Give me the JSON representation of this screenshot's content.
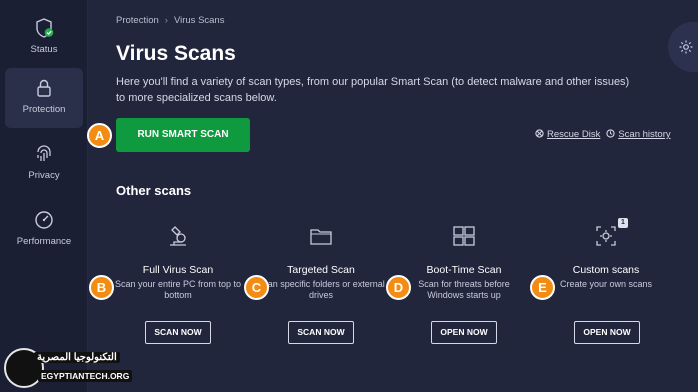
{
  "sidebar": {
    "items": [
      {
        "label": "Status",
        "icon": "shield-check-icon"
      },
      {
        "label": "Protection",
        "icon": "lock-icon"
      },
      {
        "label": "Privacy",
        "icon": "fingerprint-icon"
      },
      {
        "label": "Performance",
        "icon": "speedometer-icon"
      }
    ],
    "status_ok_color": "#22b14c"
  },
  "breadcrumb": {
    "parent": "Protection",
    "separator": "›",
    "current": "Virus Scans"
  },
  "page": {
    "title": "Virus Scans",
    "description": "Here you'll find a variety of scan types, from our popular Smart Scan (to detect malware and other issues) to more specialized scans below."
  },
  "smart_scan": {
    "label": "RUN SMART SCAN",
    "color": "#0f9a3f"
  },
  "links": {
    "rescue_disk": "Rescue Disk",
    "scan_history": "Scan history"
  },
  "other_scans": {
    "title": "Other scans",
    "items": [
      {
        "name": "Full Virus Scan",
        "subtitle": "Scan your entire PC from top to bottom",
        "button": "SCAN NOW",
        "icon": "microscope-icon"
      },
      {
        "name": "Targeted Scan",
        "subtitle": "Scan specific folders or external drives",
        "button": "SCAN NOW",
        "icon": "folder-icon"
      },
      {
        "name": "Boot-Time Scan",
        "subtitle": "Scan for threats before Windows starts up",
        "button": "OPEN NOW",
        "icon": "windows-icon"
      },
      {
        "name": "Custom scans",
        "subtitle": "Create your own scans",
        "button": "OPEN NOW",
        "icon": "custom-scan-icon",
        "badge": "1"
      }
    ]
  },
  "markers": [
    "A",
    "B",
    "C",
    "D",
    "E"
  ],
  "marker_color": "#f28c13",
  "watermark": {
    "arabic": "التكنولوجيا المصرية",
    "latin": "EGYPTIANTECH.ORG"
  }
}
